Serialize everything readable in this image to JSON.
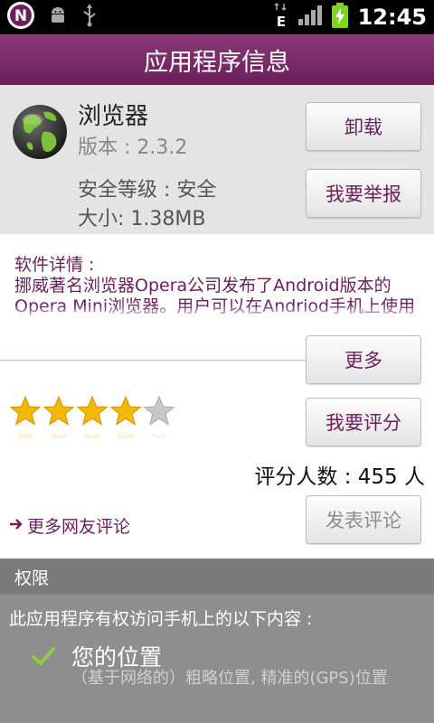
{
  "status_bar": {
    "time": "12:45",
    "left_icons": [
      "notification-n-icon",
      "android-debug-icon",
      "usb-icon"
    ],
    "right_icons": [
      "edge-data-icon",
      "signal-bars-icon",
      "battery-charging-icon"
    ],
    "edge_label": "E",
    "notify_letter": "N"
  },
  "header": {
    "title": "应用程序信息"
  },
  "app": {
    "name": "浏览器",
    "version": "版本 : 2.3.2",
    "safety": "安全等级 : 安全",
    "size": "大小: 1.38MB",
    "icon": "globe-icon"
  },
  "buttons": {
    "uninstall": "卸载",
    "report": "我要举报",
    "more": "更多",
    "rate": "我要评分",
    "post_comment": "发表评论"
  },
  "details": {
    "label": "软件详情 :",
    "description": "挪威著名浏览器Opera公司发布了Android版本的Opera Mini浏览器。用户可以在Andriod手机上使用Opera浏览器。Opera浏览器在更好的...上垢"
  },
  "rating": {
    "stars": 4,
    "max_stars": 5,
    "count_text": "评分人数 : 455 人"
  },
  "comments_link": {
    "text": "更多网友评论"
  },
  "permissions": {
    "header": "权限",
    "intro": "此应用程序有权访问手机上的以下内容 :",
    "items": [
      {
        "title": "您的位置",
        "detail": "（基于网络的）粗略位置, 精准的(GPS)位置"
      }
    ]
  },
  "colors": {
    "accent": "#6a1f5a",
    "title_bar": "#7a2a68",
    "star": "#f5b800"
  }
}
